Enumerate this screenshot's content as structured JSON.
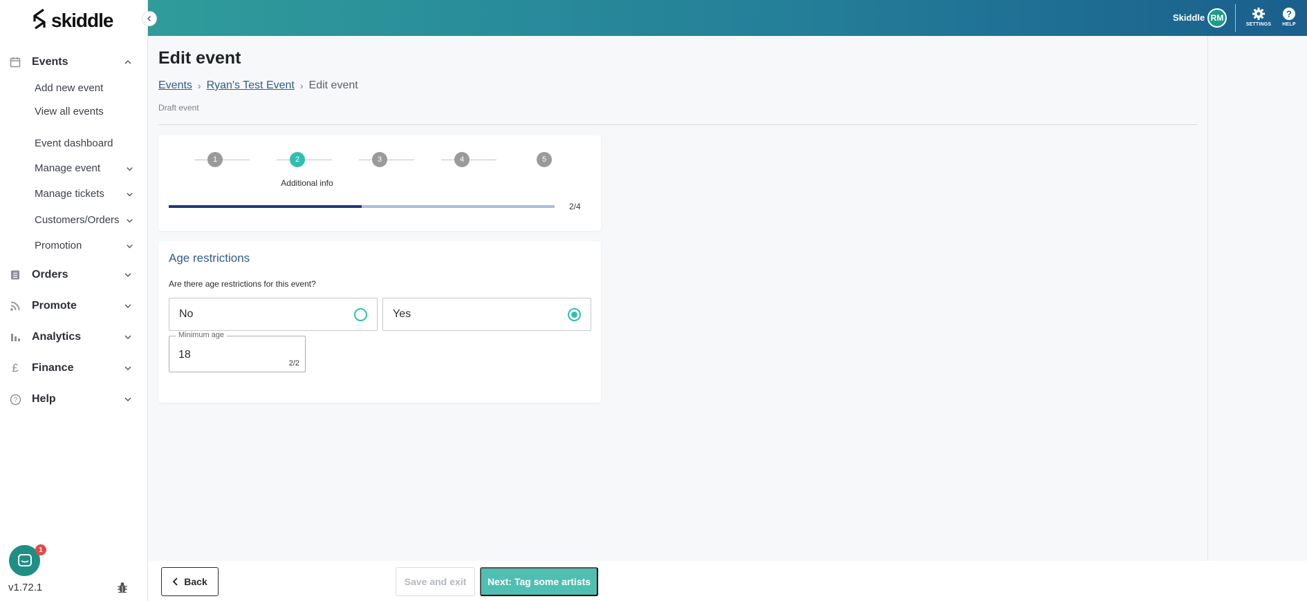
{
  "brand": {
    "name": "skiddle",
    "accent": "#2fbfb0",
    "header_gradient": [
      "#2f9c9a",
      "#1a5f8d"
    ]
  },
  "header": {
    "user_name": "Skiddle",
    "avatar_initials": "RM",
    "settings_label": "SETTINGS",
    "help_label": "HELP"
  },
  "sidebar": {
    "events": {
      "label": "Events",
      "icon": "calendar-icon",
      "items": [
        "Add new event",
        "View all events"
      ],
      "event_items": [
        "Event dashboard",
        "Manage event",
        "Manage tickets",
        "Customers/Orders",
        "Promotion"
      ]
    },
    "sections": [
      {
        "label": "Orders",
        "icon": "list-icon"
      },
      {
        "label": "Promote",
        "icon": "rss-icon"
      },
      {
        "label": "Analytics",
        "icon": "bar-chart-icon"
      },
      {
        "label": "Finance",
        "icon": "pound-icon"
      },
      {
        "label": "Help",
        "icon": "help-circle-icon"
      }
    ],
    "version": "v1.72.1",
    "chat_badge_count": "1"
  },
  "page": {
    "title": "Edit event",
    "breadcrumb": [
      "Events",
      "Ryan's Test Event",
      "Edit event"
    ],
    "breadcrumb_sep": "›",
    "status": "Draft event"
  },
  "stepper": {
    "steps": [
      "1",
      "2",
      "3",
      "4",
      "5"
    ],
    "active_step": 2,
    "active_label": "Additional info",
    "progress_fraction": 0.5,
    "progress_text": "2/4"
  },
  "age_restrictions": {
    "title": "Age restrictions",
    "question": "Are there age restrictions for this event?",
    "options": [
      {
        "label": "No",
        "selected": false
      },
      {
        "label": "Yes",
        "selected": true
      }
    ],
    "minimum_age_label": "Minimum age",
    "minimum_age_value": "18",
    "minimum_age_count": "2/2"
  },
  "footer": {
    "back_label": "Back",
    "save_label": "Save and exit",
    "next_label": "Next: Tag some artists"
  }
}
